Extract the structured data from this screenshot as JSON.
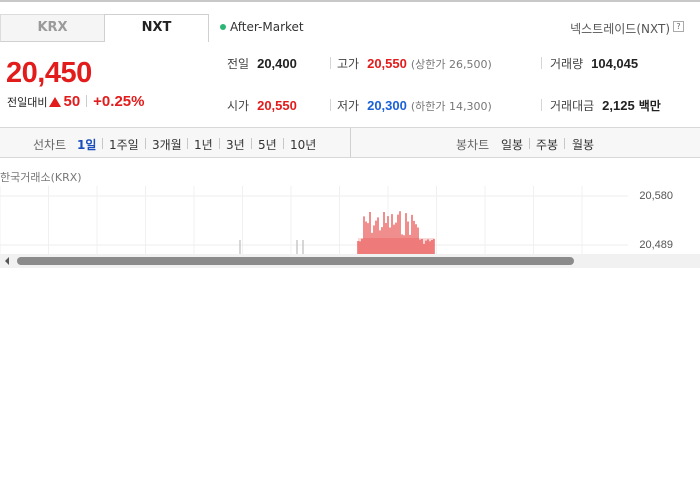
{
  "market_tabs": [
    {
      "label": "KRX",
      "active": false
    },
    {
      "label": "NXT",
      "active": true
    }
  ],
  "session_status": "After-Market",
  "nxt_link": "넥스트레이드(NXT)",
  "help_icon_glyph": "?",
  "price": {
    "current": "20,450",
    "change_label": "전일대비",
    "change_amount": "50",
    "change_percent": "+0.25%",
    "direction": "up"
  },
  "stats": {
    "prev_close": {
      "label": "전일",
      "value": "20,400"
    },
    "open": {
      "label": "시가",
      "value": "20,550"
    },
    "high": {
      "label": "고가",
      "value": "20,550",
      "limit_label": "(상한가 26,500)"
    },
    "low": {
      "label": "저가",
      "value": "20,300",
      "limit_label": "(하한가 14,300)"
    },
    "volume": {
      "label": "거래량",
      "value": "104,045"
    },
    "amount": {
      "label": "거래대금",
      "value": "2,125",
      "unit": "백만"
    }
  },
  "line_chart_toolbar": {
    "title": "선차트",
    "periods": [
      "1일",
      "1주일",
      "3개월",
      "1년",
      "3년",
      "5년",
      "10년"
    ],
    "active_period": "1일"
  },
  "candle_chart_toolbar": {
    "title": "봉차트",
    "periods": [
      "일봉",
      "주봉",
      "월봉"
    ]
  },
  "chart": {
    "exchange_label": "한국거래소(KRX)",
    "y_ticks": [
      "20,580",
      "20,489"
    ],
    "up_color": "#e21b1b",
    "neutral_color": "#c8c8c8"
  },
  "colors": {
    "up": "#e21b1b",
    "down": "#1a62d6",
    "active_tab": "#1a4dbb",
    "status_dot": "#2cb675"
  },
  "icons": {
    "status": "green-dot-icon",
    "up_change": "red-triangle-up-icon",
    "help": "question-box-icon",
    "scroll_left": "arrow-left-icon"
  }
}
